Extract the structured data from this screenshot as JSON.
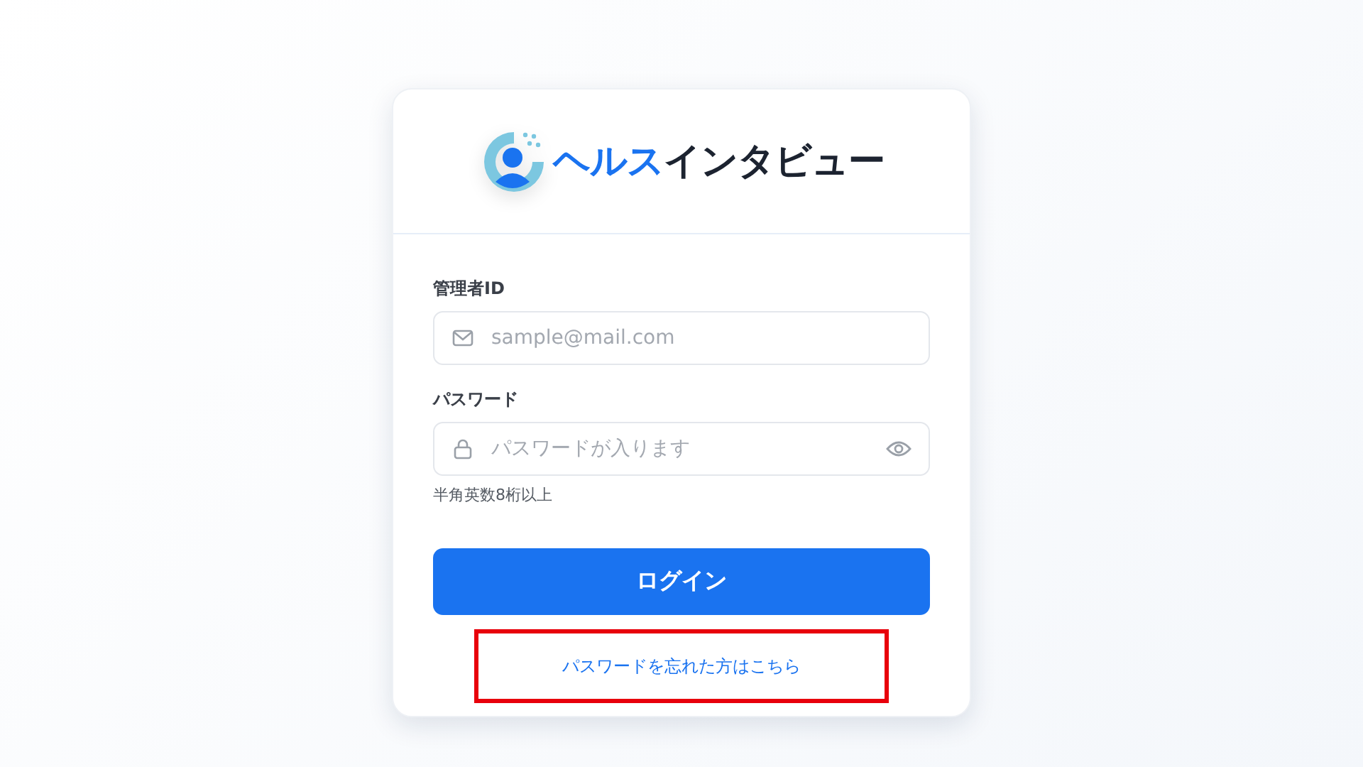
{
  "logo": {
    "accent": "ヘルス",
    "rest": "インタビュー"
  },
  "fields": [
    {
      "label": "管理者ID",
      "placeholder": "sample@mail.com",
      "kind": "email"
    },
    {
      "label": "パスワード",
      "placeholder": "パスワードが入ります",
      "kind": "password",
      "hint": "半角英数8桁以上"
    }
  ],
  "login_button": "ログイン",
  "forgot_link": {
    "label": "パスワードを忘れた方はこちら",
    "highlighted": true
  }
}
